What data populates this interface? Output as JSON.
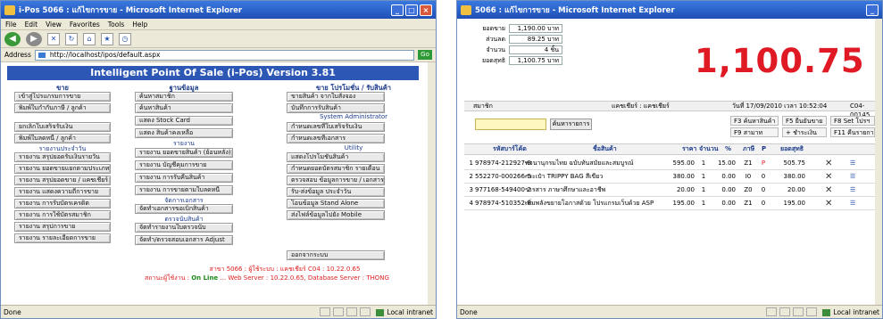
{
  "left": {
    "title": "i-Pos 5066 : แก้ไขการขาย - Microsoft Internet Explorer",
    "menu": [
      "File",
      "Edit",
      "View",
      "Favorites",
      "Tools",
      "Help"
    ],
    "address_label": "Address",
    "address": "http://localhost/ipos/default.aspx",
    "go": "Go",
    "pos_title": "Intelligent Point Of Sale (i-Pos) Version 3.81",
    "col1_head": "ขาย",
    "col2_head": "ฐานข้อมูล",
    "col3_head": "ขาย โปรโมชั่น / รับสินค้า",
    "col1_items": [
      "เข้าสู่โปรแกรมการขาย",
      "พิมพ์ใบกำกับภาษี / ลูกค้า",
      "ยกเลิกใบเสร็จรับเงิน",
      "พิมพ์ใบลดหนี้ / ลูกค้า"
    ],
    "col1_sect": "รายงานประจำวัน",
    "col1_reports": [
      "รายงาน สรุปยอดรับเงินรายวัน",
      "รายงาน ยอดขายแยกตามประเภทสินค้า",
      "รายงาน สรุปยอดขาย / แคชเชียร์",
      "รายงาน แสดงความถี่การขาย",
      "รายงาน การรับบัตรเครดิต",
      "รายงาน การใช้บัตรสมาชิก",
      "รายงาน สรุปการขาย",
      "รายงาน รายละเอียดการขาย"
    ],
    "col2_items": [
      "ค้นหาสมาชิก",
      "ค้นหาสินค้า",
      "แสดง Stock Card",
      "แสดง สินค้าคงเหลือ"
    ],
    "col2_sect1": "รายงาน",
    "col2_reports": [
      "รายงาน ยอดขายสินค้า (ย้อนหลัง)",
      "รายงาน บัญชีคุมการขาย",
      "รายงาน การรับคืนสินค้า",
      "รายงาน การขายตามใบลดหนี้"
    ],
    "col2_sect2": "จัดการเอกสาร",
    "col2_docs": [
      "จัดทำเอกสารขอเบิกสินค้า"
    ],
    "col2_sect3": "ตรวจนับสินค้า",
    "col2_counts": [
      "จัดทำรายงานใบตรวจนับ",
      "จัดทำ/ตรวจสอบเอกสาร Adjust"
    ],
    "col3_items": [
      "ขายสินค้า จากใบสั่งจอง",
      "บันทึกการรับสินค้า"
    ],
    "col3_sect1": "System Administrator",
    "col3_admin": [
      "กำหนดเลขที่ใบเสร็จรับเงิน",
      "กำหนดเลขที่เอกสาร"
    ],
    "col3_sect2": "Utility",
    "col3_util": [
      "แสดงโปรโมชั่นสินค้า",
      "กำหนดยอดบัตรสมาชิก รายเดือน",
      "ตรวจสอบ ข้อมูลการขาย / เอกสาร",
      "รับ-ส่งข้อมูล ประจำวัน",
      "โอนข้อมูล Stand Alone",
      "ส่งไฟล์ข้อมูลไปยัง Mobile"
    ],
    "col3_exit": "ออกจากระบบ",
    "footer1": "สาขา 5066 : ผู้ใช้ระบบ : แคชเชียร์ C04 : 10.22.0.65",
    "footer2_a": "สถานะผู้ใช้งาน : ",
    "footer2_b": "On Line",
    "footer2_c": " ... Web Server : 10.22.0.65, Database Server : THONG",
    "status": "Done",
    "zone": "Local intranet"
  },
  "right": {
    "title": "5066 : แก้ไขการขาย - Microsoft Internet Explorer",
    "info": [
      {
        "label": "ยอดขาย",
        "value": "1,190.00 บาท"
      },
      {
        "label": "ส่วนลด",
        "value": "89.25 บาท"
      },
      {
        "label": "จำนวน",
        "value": "4 ชิ้น"
      },
      {
        "label": "ยอดสุทธิ",
        "value": "1,100.75 บาท"
      }
    ],
    "big_total": "1,100.75",
    "bar_a": "สมาชิก",
    "bar_b": "แคชเชียร์ : แคชเชียร์",
    "bar_date": "วันที่ 17/09/2010 เวลา 10:52:04",
    "bar_doc": "C04-00145",
    "search_button": "ค้นหารายการ",
    "fkeys": [
      "F3 ค้นหาสินค้า",
      "F5 ยืนยันขาย",
      "F8 Set โปรฯ",
      "F9 สามาท",
      "+ ชำระเงิน",
      "F11 คืนรายการ"
    ],
    "headers": [
      "รหัสบาร์โค้ด",
      "ชื่อสินค้า",
      "ราคา",
      "จำนวน",
      "%",
      "ภาษี",
      "P",
      "ยอดสุทธิ"
    ],
    "rows": [
      {
        "no": "1",
        "code": "978974-212927-9",
        "name": "พจนานุกรมไทย ฉบับทันสมัยและสมบูรณ์",
        "price": "595.00",
        "qty": "1",
        "pct": "15.00",
        "vat": "Z1",
        "p": "P",
        "net": "505.75"
      },
      {
        "no": "2",
        "code": "552270-000266-5",
        "name": "กระเป๋า TRIPPY BAG สีเขียว",
        "price": "380.00",
        "qty": "1",
        "pct": "0.00",
        "vat": "I0",
        "p": "0",
        "net": "380.00"
      },
      {
        "no": "3",
        "code": "977168-549400-2",
        "name": "วารสาร ภาษาศึกษาและอาชีพ",
        "price": "20.00",
        "qty": "1",
        "pct": "0.00",
        "vat": "Z0",
        "p": "0",
        "net": "20.00"
      },
      {
        "no": "4",
        "code": "978974-510352-8",
        "name": "เพิ่มพลังขยายโอกาสด้วย โปรแกรมเว็บด้วย ASP",
        "price": "195.00",
        "qty": "1",
        "pct": "0.00",
        "vat": "Z1",
        "p": "0",
        "net": "195.00"
      }
    ],
    "status": "Done",
    "zone": "Local intranet"
  }
}
